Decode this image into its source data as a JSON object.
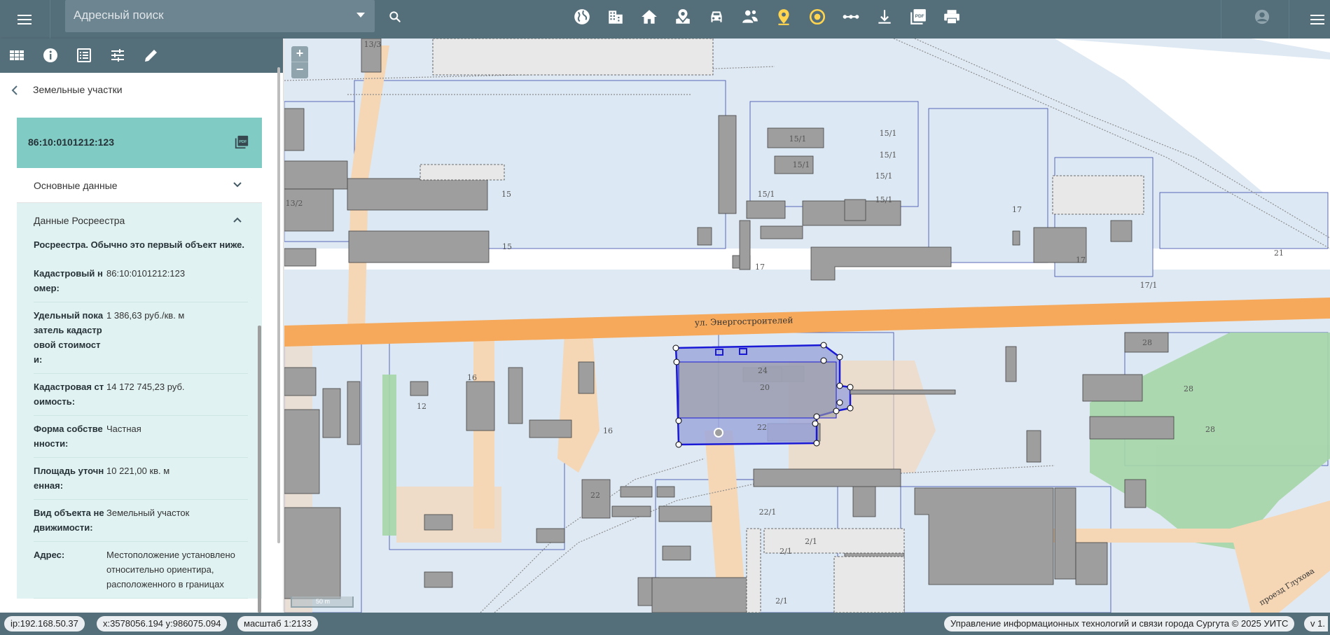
{
  "header": {
    "search_placeholder": "Адресный поиск",
    "tools": [
      "globe-icon",
      "buildings-icon",
      "home-icon",
      "plot-marker-icon",
      "car-icon",
      "people-icon",
      "location-pin-icon",
      "target-icon",
      "measure-icon",
      "download-icon",
      "pdf-icon",
      "print-icon"
    ]
  },
  "sidebar": {
    "back_label": "Земельные участки",
    "card_title": "86:10:0101212:123",
    "sections": {
      "basic": "Основные данные",
      "rosreestr": "Данные Росреестра"
    },
    "note": "Росреестра. Обычно это первый объект ниже.",
    "rows": [
      {
        "key": "Кадастровый номер:",
        "value": "86:10:0101212:123"
      },
      {
        "key": "Удельный показатель кадастровой стоимости:",
        "value": "1 386,63 руб./кв. м"
      },
      {
        "key": "Кадастровая стоимость:",
        "value": "14 172 745,23 руб."
      },
      {
        "key": "Форма собственности:",
        "value": "Частная"
      },
      {
        "key": "Площадь уточненная:",
        "value": "10 221,00 кв. м"
      },
      {
        "key": "Вид объекта недвижимости:",
        "value": "Земельный участок"
      },
      {
        "key": "Адрес:",
        "value": "Местоположение установлено относительно ориентира, расположенного в границах"
      }
    ]
  },
  "map": {
    "zoom_in": "+",
    "zoom_out": "−",
    "scale_label": "50 m",
    "street_label": "ул. Энергостроителей",
    "street_label_2": "проезд Глухова",
    "labels": [
      "13/3",
      "13/2",
      "15",
      "15",
      "15/1",
      "15/1",
      "15/1",
      "15/1",
      "15/1",
      "15/1",
      "15/1",
      "17",
      "17",
      "17",
      "17/1",
      "21",
      "24",
      "20",
      "22",
      "16",
      "16",
      "12",
      "22",
      "22/1",
      "2/1",
      "2/1",
      "2/1",
      "28",
      "28",
      "28"
    ]
  },
  "status": {
    "ip": "ip:192.168.50.37",
    "coords": "x:3578056.194 y:986075.094",
    "scale": "масштаб 1:2133",
    "copyright": "Управление информационных технологий и связи города Сургута © 2025 УИТС",
    "version": "v 1."
  }
}
